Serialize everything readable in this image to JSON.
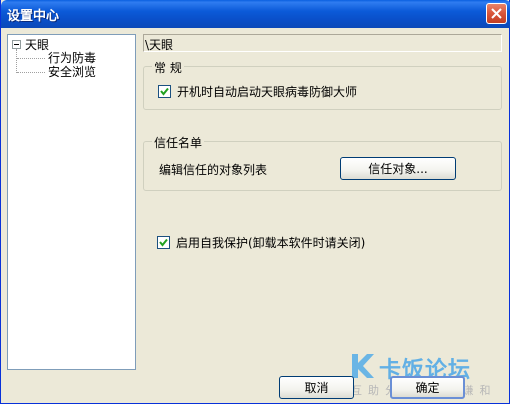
{
  "window": {
    "title": "设置中心"
  },
  "tree": {
    "root": "天眼",
    "children": [
      "行为防毒",
      "安全浏览"
    ]
  },
  "path": "\\天眼",
  "general": {
    "legend": "常 规",
    "autostart_label": "开机时自动启动天眼病毒防御大师",
    "autostart_checked": true
  },
  "trust": {
    "legend": "信任名单",
    "description": "编辑信任的对象列表",
    "button_label": "信任对象..."
  },
  "selfprotect": {
    "label": "启用自我保护(卸载本软件时请关闭)",
    "checked": true
  },
  "footer": {
    "cancel_label": "取消",
    "ok_label": "确定"
  },
  "watermark": {
    "logo_text": "卡饭论坛",
    "sub_text": "互助分享 大气谦和"
  }
}
